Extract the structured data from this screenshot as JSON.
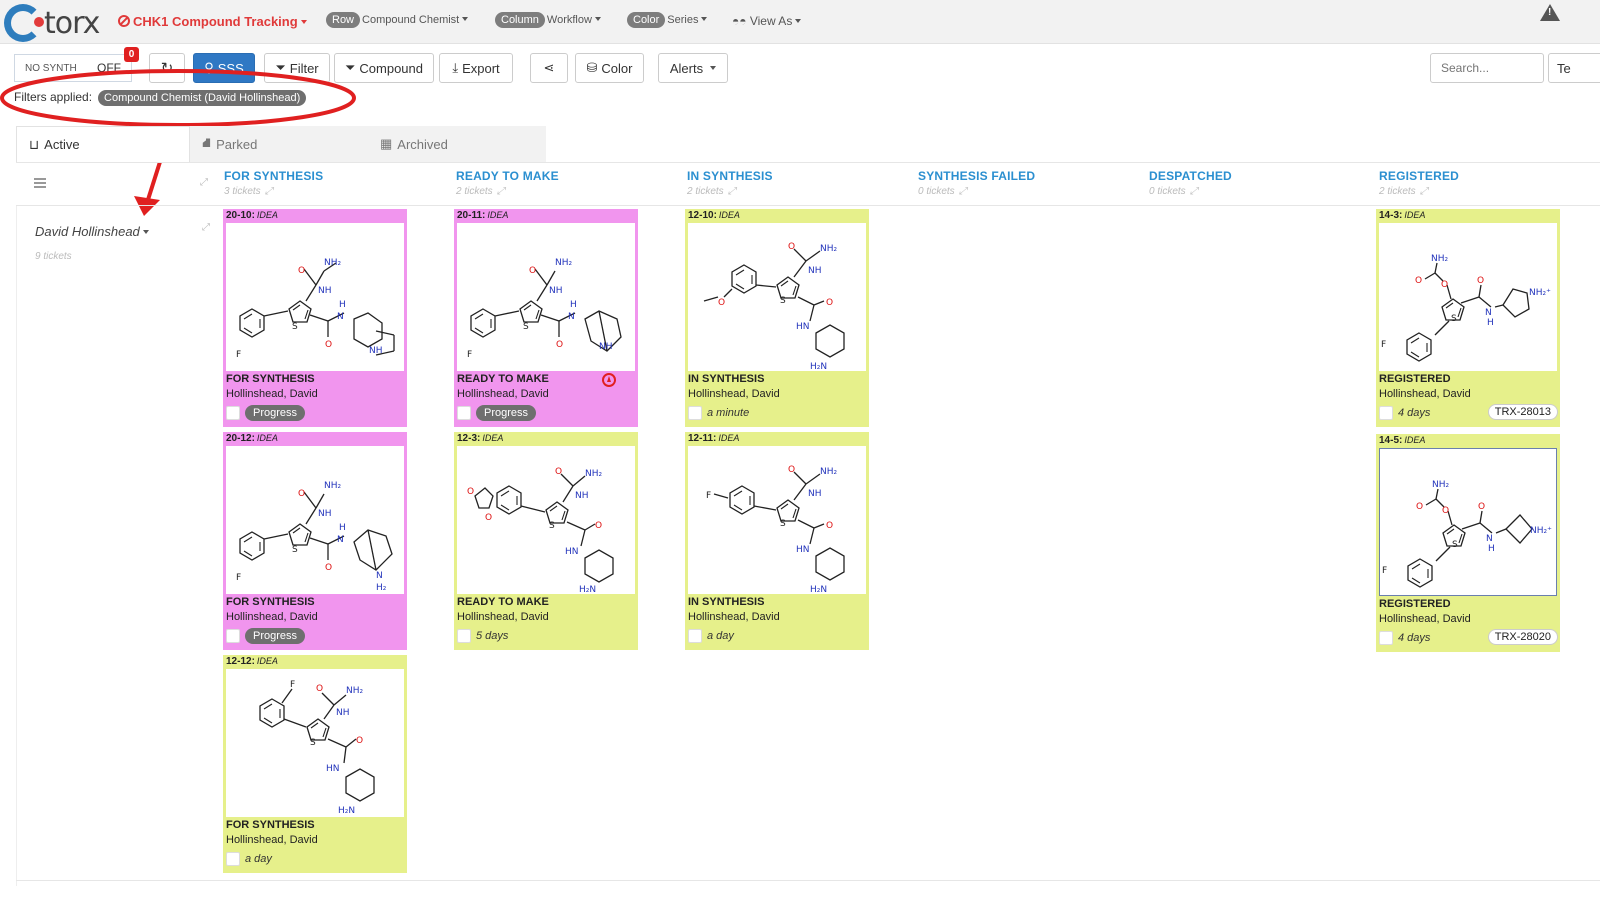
{
  "header": {
    "logo": "torx",
    "project": "CHK1 Compound Tracking",
    "groupings": [
      {
        "pill": "Row",
        "value": "Compound Chemist"
      },
      {
        "pill": "Column",
        "value": "Workflow"
      },
      {
        "pill": "Color",
        "value": "Series"
      }
    ],
    "view_as": "View As"
  },
  "toolbar": {
    "toggle_left": "NO SYNTH",
    "toggle_right": "OFF",
    "badge": "0",
    "sss": "SSS",
    "filter": "Filter",
    "compound": "Compound",
    "export": "Export",
    "color": "Color",
    "alerts": "Alerts",
    "search_placeholder": "Search...",
    "te": "Te"
  },
  "filters": {
    "label": "Filters applied:",
    "pill": "Compound Chemist (David Hollinshead)"
  },
  "tabs": [
    {
      "label": "Active"
    },
    {
      "label": "Parked"
    },
    {
      "label": "Archived"
    }
  ],
  "columns": [
    {
      "title": "FOR SYNTHESIS",
      "count": "3 tickets"
    },
    {
      "title": "READY TO MAKE",
      "count": "2 tickets"
    },
    {
      "title": "IN SYNTHESIS",
      "count": "2 tickets"
    },
    {
      "title": "SYNTHESIS FAILED",
      "count": "0 tickets"
    },
    {
      "title": "DESPATCHED",
      "count": "0 tickets"
    },
    {
      "title": "REGISTERED",
      "count": "2 tickets"
    }
  ],
  "lane": {
    "name": "David Hollinshead",
    "count": "9 tickets"
  },
  "cards": [
    {
      "id": "20-10:",
      "tag": "IDEA",
      "status": "FOR SYNTHESIS",
      "owner": "Hollinshead, David",
      "progress": "Progress",
      "color": "#f195ee"
    },
    {
      "id": "20-12:",
      "tag": "IDEA",
      "status": "FOR SYNTHESIS",
      "owner": "Hollinshead, David",
      "progress": "Progress",
      "color": "#f195ee"
    },
    {
      "id": "12-12:",
      "tag": "IDEA",
      "status": "FOR SYNTHESIS",
      "owner": "Hollinshead, David",
      "age": "a day",
      "color": "#e6f08b"
    },
    {
      "id": "20-11:",
      "tag": "IDEA",
      "status": "READY TO MAKE",
      "owner": "Hollinshead, David",
      "progress": "Progress",
      "color": "#f195ee"
    },
    {
      "id": "12-3:",
      "tag": "IDEA",
      "status": "READY TO MAKE",
      "owner": "Hollinshead, David",
      "age": "5 days",
      "color": "#e6f08b"
    },
    {
      "id": "12-10:",
      "tag": "IDEA",
      "status": "IN SYNTHESIS",
      "owner": "Hollinshead, David",
      "age": "a minute",
      "color": "#e6f08b"
    },
    {
      "id": "12-11:",
      "tag": "IDEA",
      "status": "IN SYNTHESIS",
      "owner": "Hollinshead, David",
      "age": "a day",
      "color": "#e6f08b"
    },
    {
      "id": "14-3:",
      "tag": "IDEA",
      "status": "REGISTERED",
      "owner": "Hollinshead, David",
      "age": "4 days",
      "trx": "TRX-28013",
      "color": "#e6f08b"
    },
    {
      "id": "14-5:",
      "tag": "IDEA",
      "status": "REGISTERED",
      "owner": "Hollinshead, David",
      "age": "4 days",
      "trx": "TRX-28020",
      "color": "#e6f08b"
    }
  ],
  "molecule_labels": {
    "nh2": "NH₂",
    "nh": "NH",
    "h": "H",
    "n": "N",
    "o": "O",
    "s": "S",
    "f": "F",
    "hn": "HN",
    "h2n": "H₂N",
    "h2": "H₂",
    "nh2plus": "NH₂⁺"
  }
}
